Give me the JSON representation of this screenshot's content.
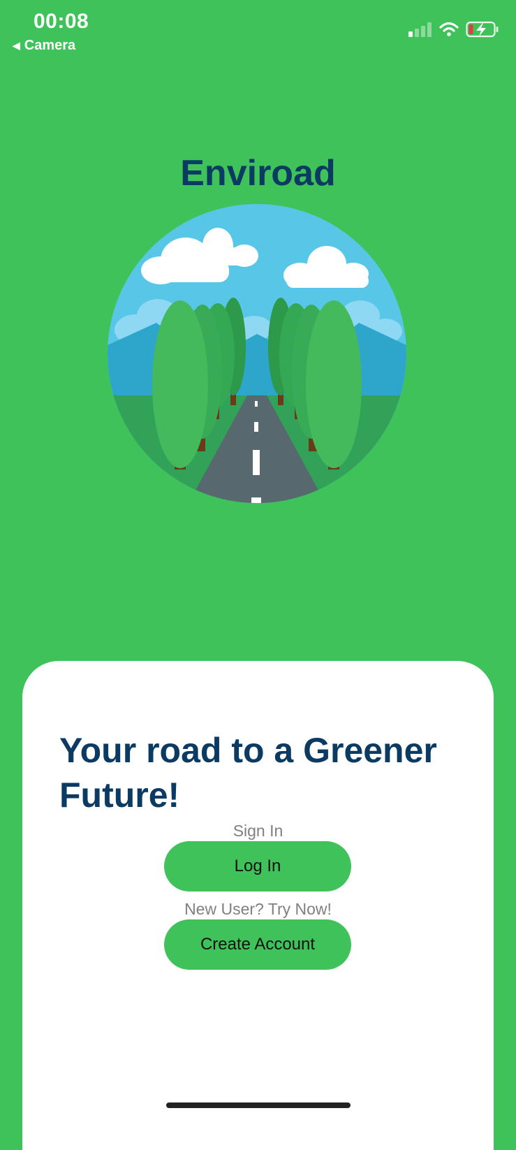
{
  "status_bar": {
    "time": "00:08",
    "back_label": "Camera"
  },
  "app": {
    "title": "Enviroad"
  },
  "card": {
    "headline": "Your road to a Greener Future!",
    "sign_in_caption": "Sign In",
    "login_button": "Log In",
    "new_user_caption": "New User? Try Now!",
    "create_account_button": "Create Account"
  },
  "colors": {
    "background": "#40C25A",
    "title": "#0B3B62",
    "card": "#FFFFFF",
    "caption": "#808080"
  },
  "icons": {
    "back": "back-arrow-icon",
    "signal": "cellular-signal-icon",
    "wifi": "wifi-icon",
    "battery": "battery-charging-icon"
  }
}
